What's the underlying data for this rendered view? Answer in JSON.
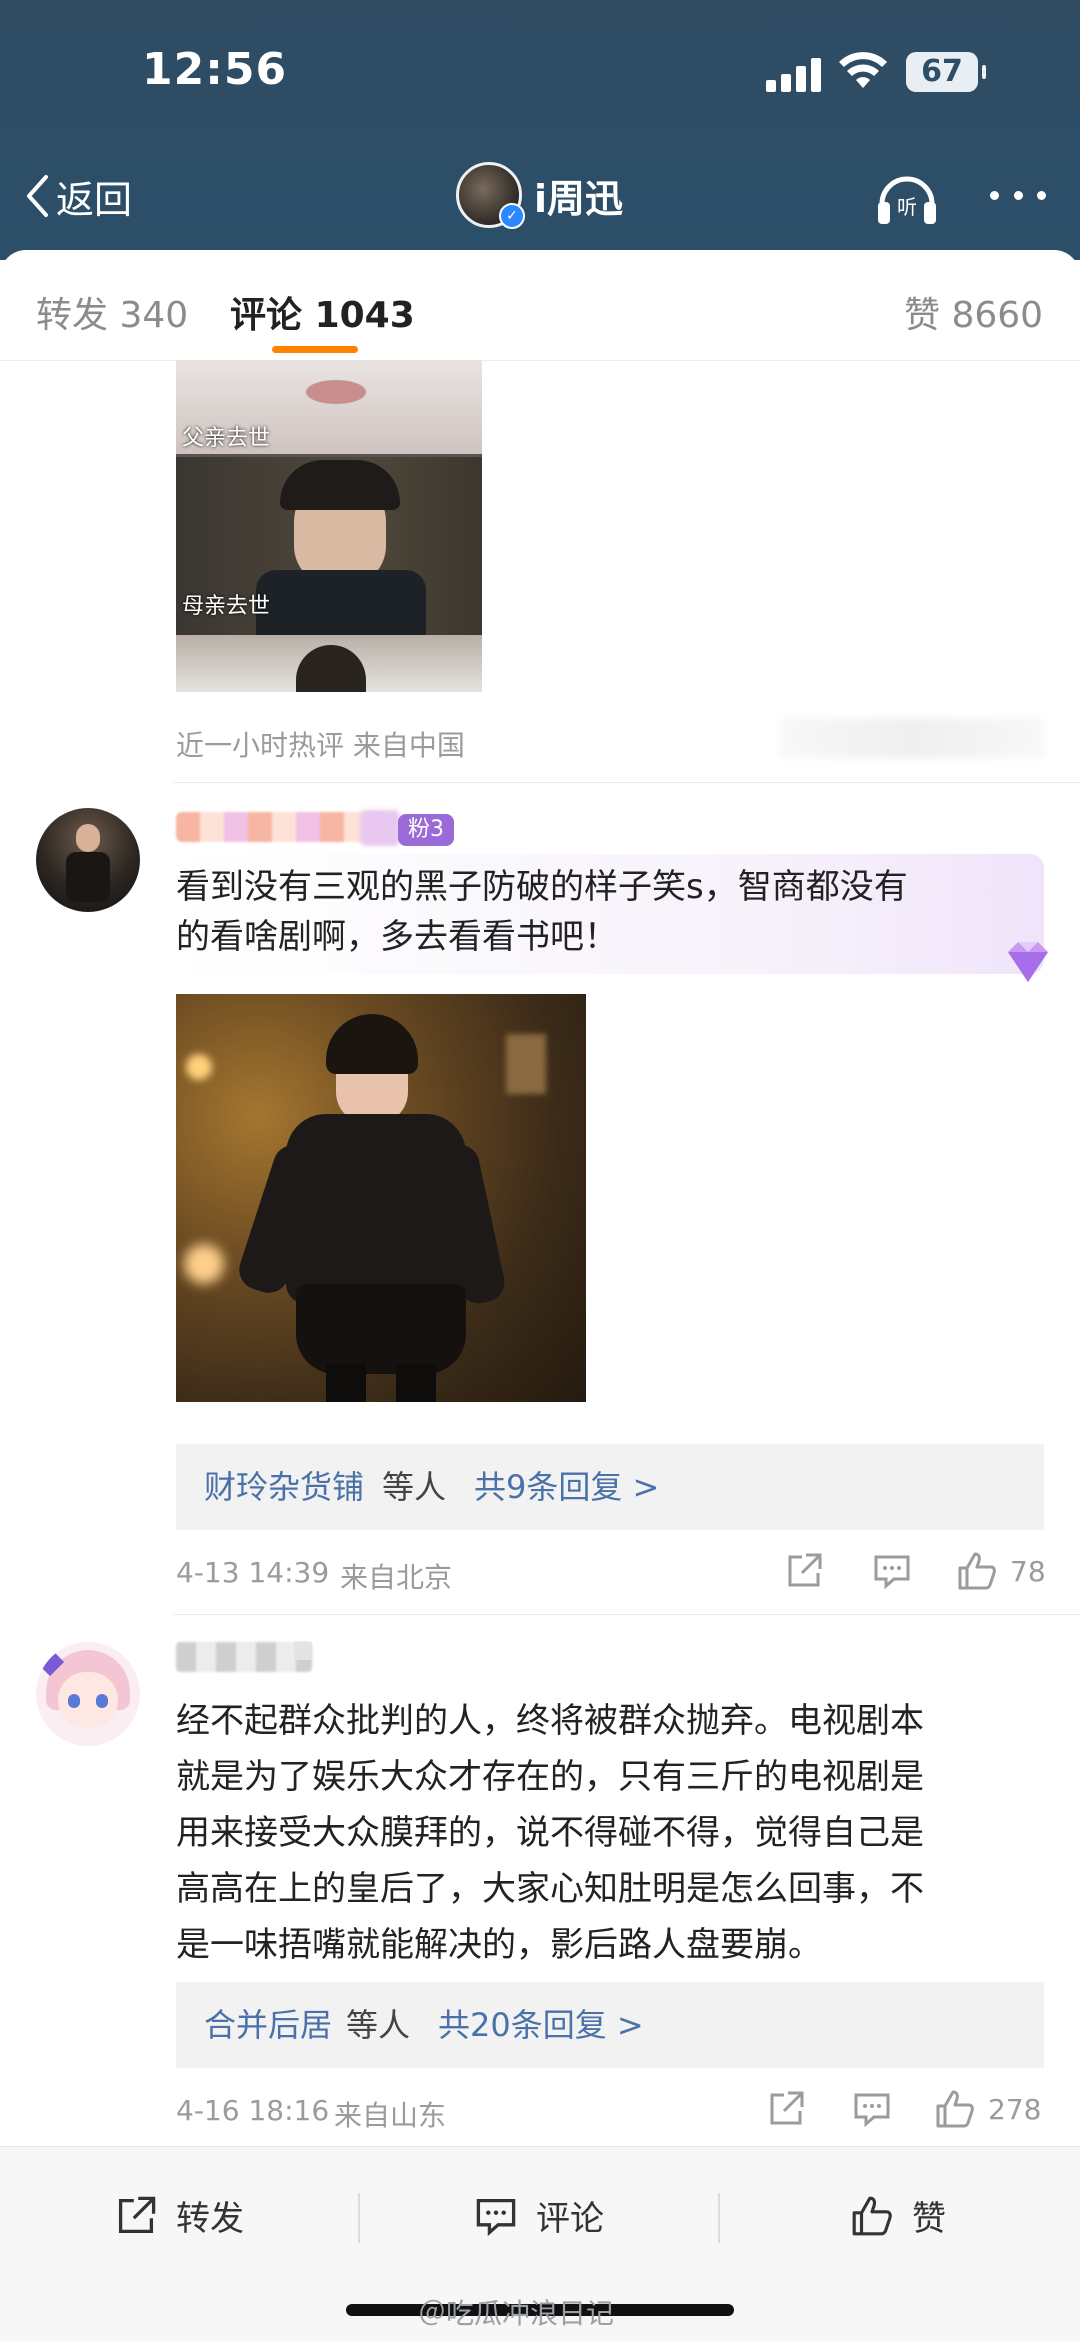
{
  "status": {
    "time": "12:56",
    "battery": "67"
  },
  "nav": {
    "back_label": "返回",
    "account_name": "i周迅"
  },
  "tabs": [
    {
      "label": "转发",
      "count": "340"
    },
    {
      "label": "评论",
      "count": "1043"
    },
    {
      "label": "赞",
      "count": "8660"
    }
  ],
  "top_image": {
    "caption_1": "父亲去世",
    "caption_2": "母亲去世"
  },
  "top_meta": {
    "line": "近一小时热评  来自中国"
  },
  "comment1": {
    "fan_badge": "粉3",
    "text_line1": "看到没有三观的黑子防破的样子笑s，智商都没有",
    "text_line2": "的看啥剧啊，多去看看书吧！",
    "replies_user": "财玲杂货铺",
    "replies_etc": "等人",
    "replies_count": "共9条回复 >",
    "time": "4-13 14:39",
    "location": "来自北京",
    "likes": "78"
  },
  "comment2": {
    "lines": [
      "经不起群众批判的人，终将被群众抛弃。电视剧本",
      "就是为了娱乐大众才存在的，只有三斤的电视剧是",
      "用来接受大众膜拜的，说不得碰不得，觉得自己是",
      "高高在上的皇后了，大家心知肚明是怎么回事，不",
      "是一味捂嘴就能解决的，影后路人盘要崩。"
    ],
    "replies_user": "合并后居",
    "replies_etc": "等人",
    "replies_count": "共20条回复 >",
    "time": "4-16 18:16",
    "location": "来自山东",
    "likes": "278"
  },
  "bottom": {
    "repost": "转发",
    "comment": "评论",
    "like": "赞"
  },
  "watermark": "＠吃瓜冲浪日记",
  "colors": {
    "header_bg": "#2b4f69",
    "accent": "#ff8200",
    "link": "#4a72a8"
  }
}
